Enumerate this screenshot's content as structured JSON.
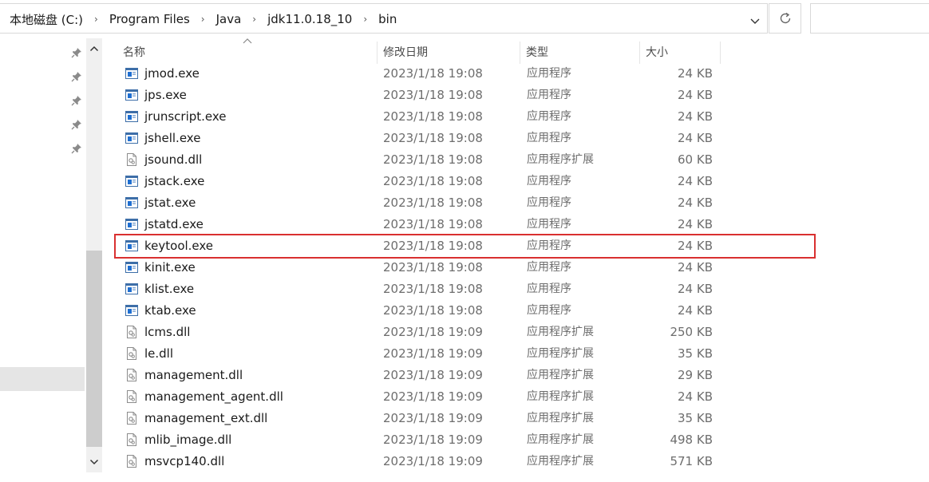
{
  "breadcrumb": [
    "本地磁盘 (C:)",
    "Program Files",
    "Java",
    "jdk11.0.18_10",
    "bin"
  ],
  "columns": {
    "name": "名称",
    "modified": "修改日期",
    "type": "类型",
    "size": "大小"
  },
  "files": [
    {
      "name": "jmod.exe",
      "modified": "2023/1/18 19:08",
      "type": "应用程序",
      "size": "24 KB",
      "icon": "exe-icon"
    },
    {
      "name": "jps.exe",
      "modified": "2023/1/18 19:08",
      "type": "应用程序",
      "size": "24 KB",
      "icon": "exe-icon"
    },
    {
      "name": "jrunscript.exe",
      "modified": "2023/1/18 19:08",
      "type": "应用程序",
      "size": "24 KB",
      "icon": "exe-icon"
    },
    {
      "name": "jshell.exe",
      "modified": "2023/1/18 19:08",
      "type": "应用程序",
      "size": "24 KB",
      "icon": "exe-icon"
    },
    {
      "name": "jsound.dll",
      "modified": "2023/1/18 19:08",
      "type": "应用程序扩展",
      "size": "60 KB",
      "icon": "dll-icon"
    },
    {
      "name": "jstack.exe",
      "modified": "2023/1/18 19:08",
      "type": "应用程序",
      "size": "24 KB",
      "icon": "exe-icon"
    },
    {
      "name": "jstat.exe",
      "modified": "2023/1/18 19:08",
      "type": "应用程序",
      "size": "24 KB",
      "icon": "exe-icon"
    },
    {
      "name": "jstatd.exe",
      "modified": "2023/1/18 19:08",
      "type": "应用程序",
      "size": "24 KB",
      "icon": "exe-icon"
    },
    {
      "name": "keytool.exe",
      "modified": "2023/1/18 19:08",
      "type": "应用程序",
      "size": "24 KB",
      "icon": "exe-icon"
    },
    {
      "name": "kinit.exe",
      "modified": "2023/1/18 19:08",
      "type": "应用程序",
      "size": "24 KB",
      "icon": "exe-icon"
    },
    {
      "name": "klist.exe",
      "modified": "2023/1/18 19:08",
      "type": "应用程序",
      "size": "24 KB",
      "icon": "exe-icon"
    },
    {
      "name": "ktab.exe",
      "modified": "2023/1/18 19:08",
      "type": "应用程序",
      "size": "24 KB",
      "icon": "exe-icon"
    },
    {
      "name": "lcms.dll",
      "modified": "2023/1/18 19:09",
      "type": "应用程序扩展",
      "size": "250 KB",
      "icon": "dll-icon"
    },
    {
      "name": "le.dll",
      "modified": "2023/1/18 19:09",
      "type": "应用程序扩展",
      "size": "35 KB",
      "icon": "dll-icon"
    },
    {
      "name": "management.dll",
      "modified": "2023/1/18 19:09",
      "type": "应用程序扩展",
      "size": "29 KB",
      "icon": "dll-icon"
    },
    {
      "name": "management_agent.dll",
      "modified": "2023/1/18 19:09",
      "type": "应用程序扩展",
      "size": "24 KB",
      "icon": "dll-icon"
    },
    {
      "name": "management_ext.dll",
      "modified": "2023/1/18 19:09",
      "type": "应用程序扩展",
      "size": "35 KB",
      "icon": "dll-icon"
    },
    {
      "name": "mlib_image.dll",
      "modified": "2023/1/18 19:09",
      "type": "应用程序扩展",
      "size": "498 KB",
      "icon": "dll-icon"
    },
    {
      "name": "msvcp140.dll",
      "modified": "2023/1/18 19:09",
      "type": "应用程序扩展",
      "size": "571 KB",
      "icon": "dll-icon"
    }
  ],
  "highlighted_file": "keytool.exe",
  "colors": {
    "highlight_border": "#d93030",
    "exe_icon_blue": "#1f6fd1"
  }
}
